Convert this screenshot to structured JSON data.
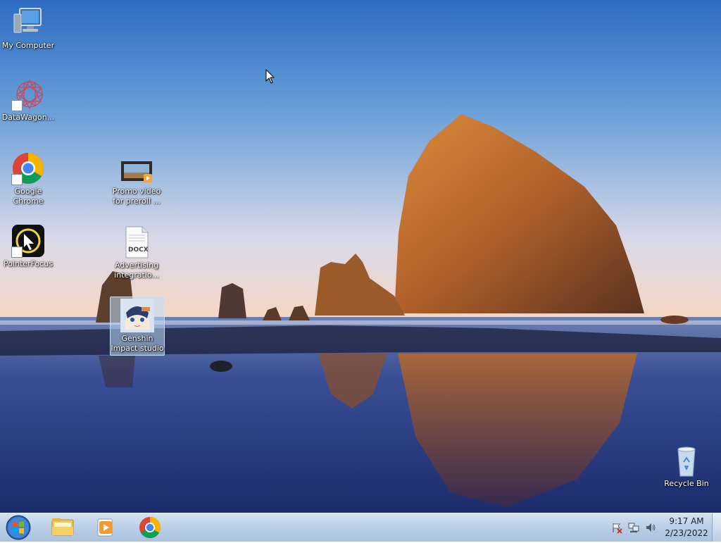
{
  "desktop": {
    "icons": [
      {
        "id": "my-computer",
        "label": "My Computer"
      },
      {
        "id": "datawagon",
        "label": "DataWagon..."
      },
      {
        "id": "google-chrome",
        "label": "Google Chrome"
      },
      {
        "id": "promo-video",
        "label": "Promo video for preroll ..."
      },
      {
        "id": "pointerfocus",
        "label": "PointerFocus"
      },
      {
        "id": "advertising-doc",
        "label": "Advertising integratio...",
        "file_badge": "DOCX"
      },
      {
        "id": "genshin",
        "label": "Genshin Impact studio"
      },
      {
        "id": "recycle-bin",
        "label": "Recycle Bin"
      }
    ]
  },
  "taskbar": {
    "items": [
      "start-icon",
      "file-explorer-icon",
      "media-player-icon",
      "chrome-icon"
    ],
    "tray": {
      "icons": [
        "action-center-flag-icon",
        "network-icon",
        "volume-icon"
      ],
      "time": "9:17 AM",
      "date": "2/23/2022"
    }
  },
  "colors": {
    "taskbar_top": "#d3e3f3",
    "taskbar_bottom": "#a9c2de",
    "sky_top": "#2f6fc4",
    "sky_bottom": "#f6d7c6",
    "rock": "#b86a2a",
    "water": "#2a3e86"
  }
}
